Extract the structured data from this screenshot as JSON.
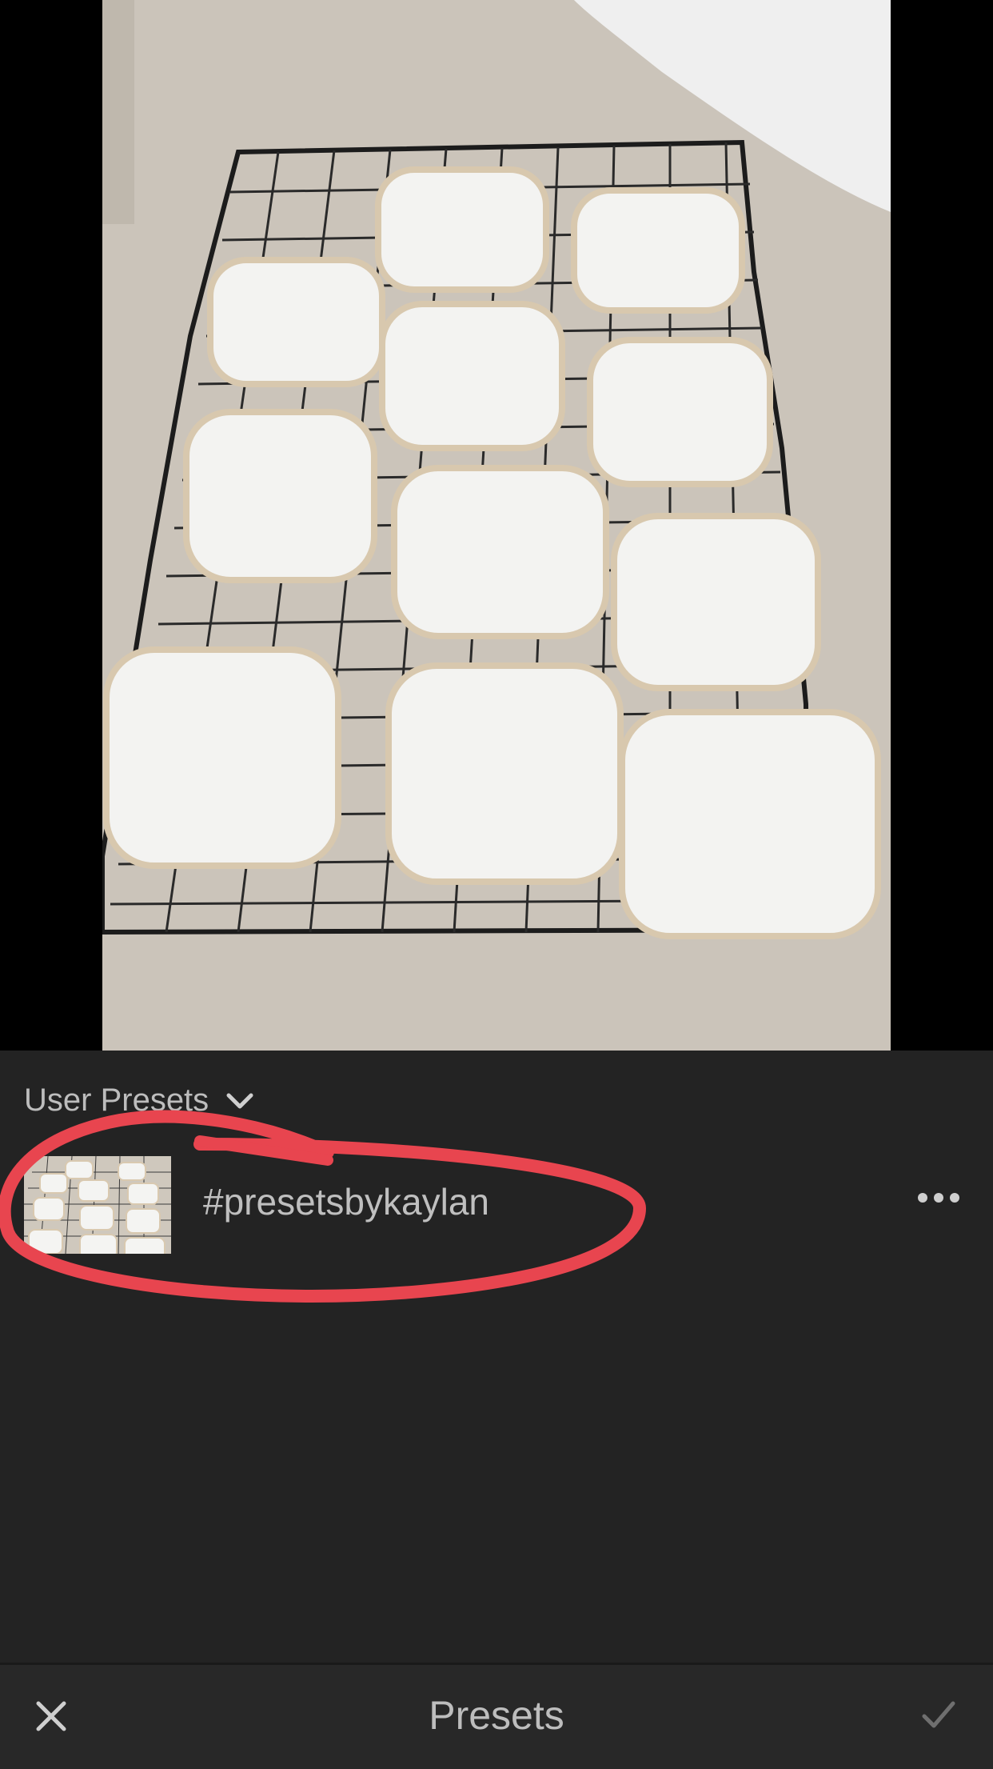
{
  "photo": {
    "subject": "cookies-on-cooling-rack"
  },
  "presets": {
    "group_label": "User Presets",
    "items": [
      {
        "name": "#presetsbykaylan"
      }
    ]
  },
  "toolbar": {
    "title": "Presets",
    "close_icon": "close-icon",
    "confirm_icon": "checkmark-icon"
  },
  "colors": {
    "panel_bg": "#232323",
    "annotation": "#e8454f",
    "text": "#bdbdbd"
  }
}
